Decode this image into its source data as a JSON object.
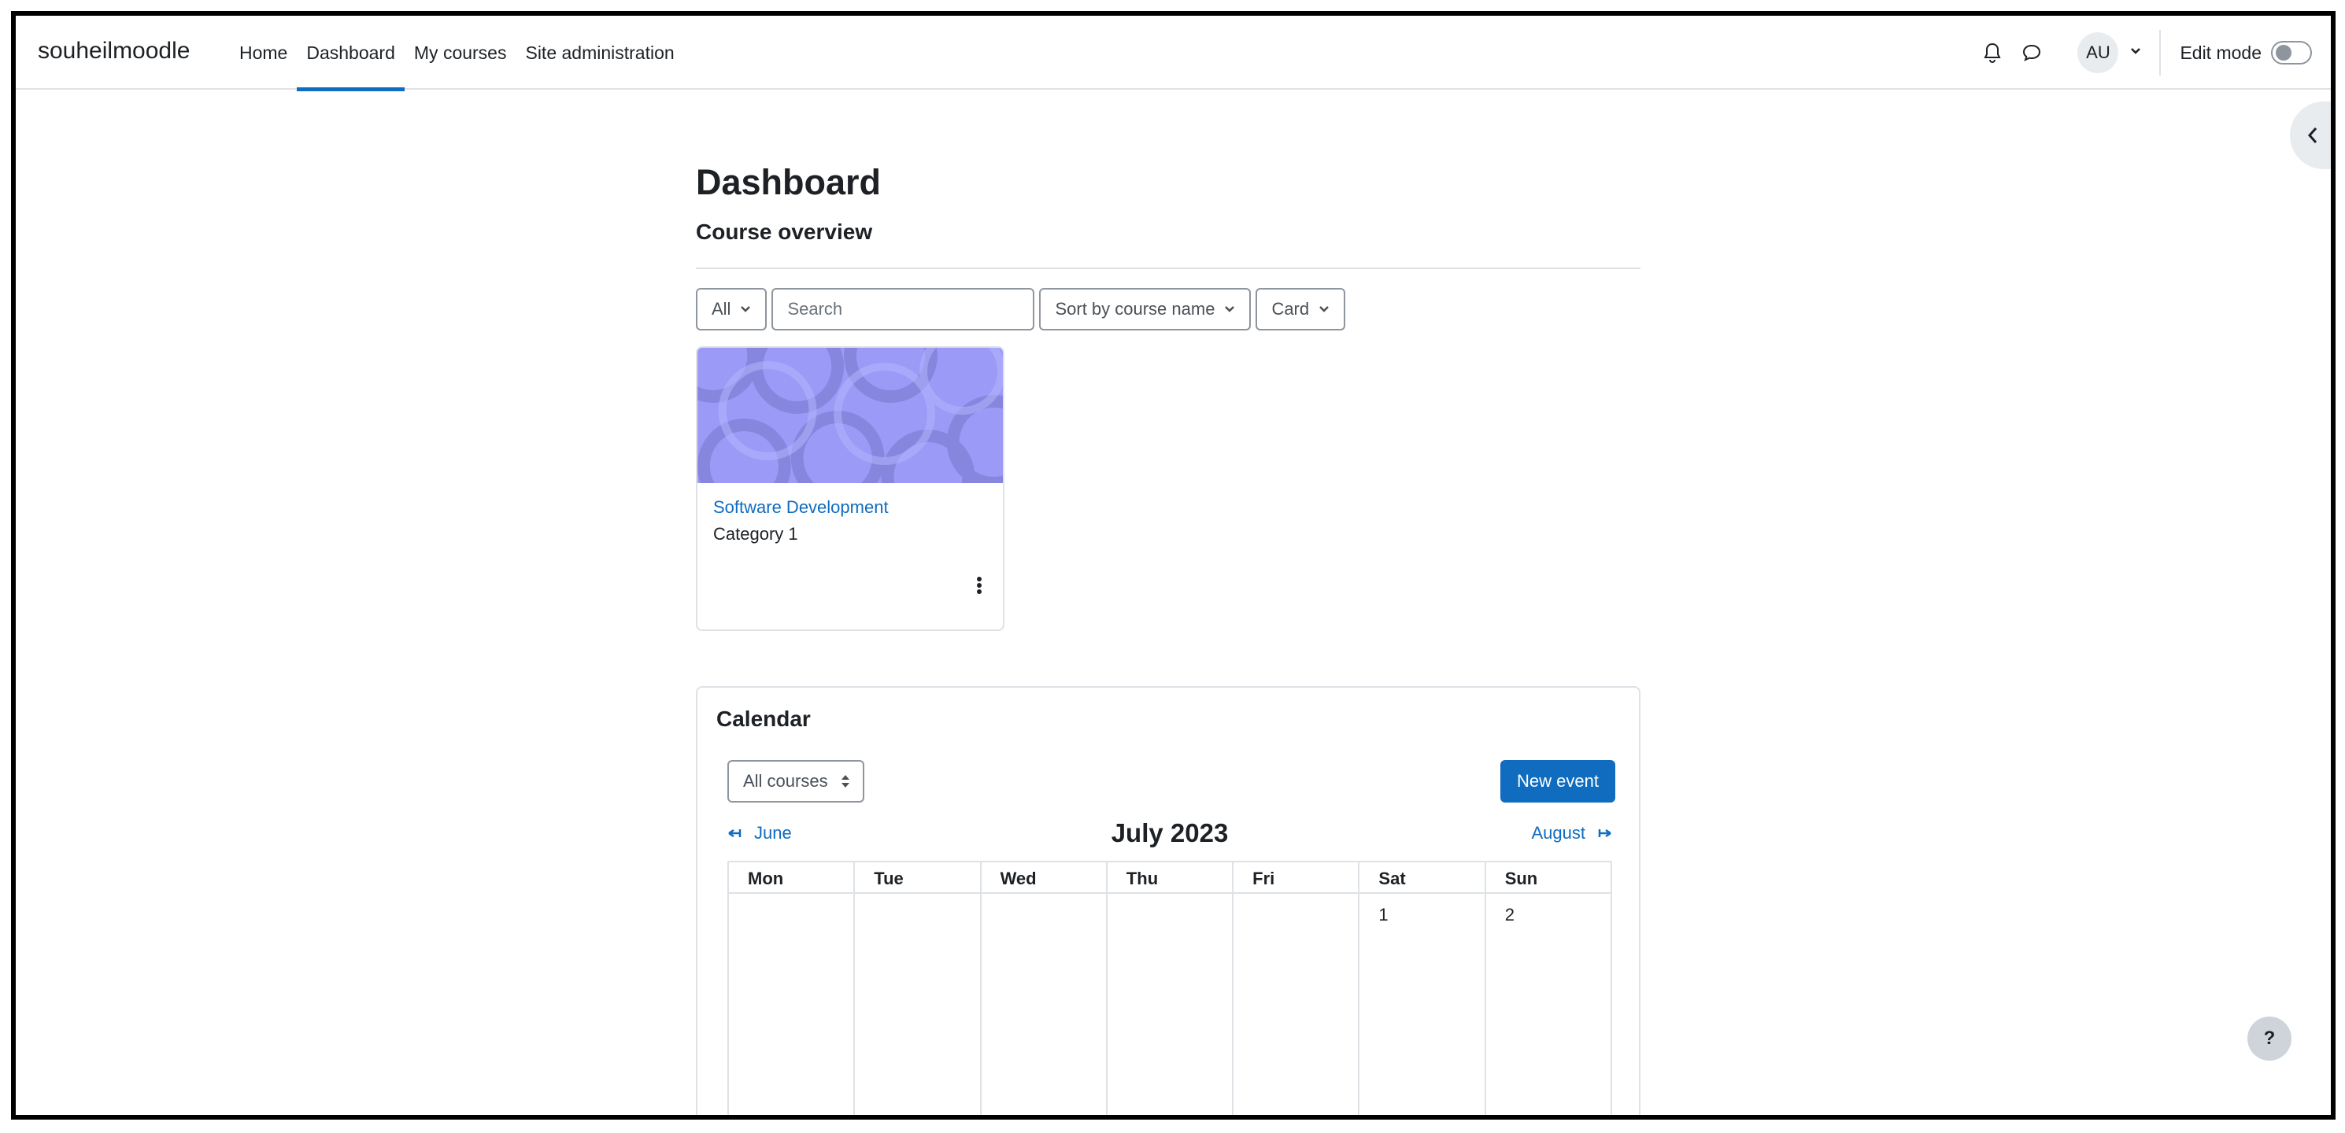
{
  "navbar": {
    "brand": "souheilmoodle",
    "links": [
      "Home",
      "Dashboard",
      "My courses",
      "Site administration"
    ],
    "active_link": "Dashboard",
    "user_initials": "AU",
    "edit_mode_label": "Edit mode",
    "edit_mode_on": false
  },
  "main": {
    "page_title": "Dashboard",
    "block_title": "Course overview",
    "filters": {
      "grouping": "All",
      "search_placeholder": "Search",
      "sort": "Sort by course name",
      "view": "Card"
    },
    "courses": [
      {
        "name": "Software Development",
        "category": "Category 1"
      }
    ]
  },
  "calendar": {
    "title": "Calendar",
    "course_filter": "All courses",
    "new_event_label": "New event",
    "prev_month": "June",
    "current_month": "July 2023",
    "next_month": "August",
    "weekdays": [
      "Mon",
      "Tue",
      "Wed",
      "Thu",
      "Fri",
      "Sat",
      "Sun"
    ],
    "first_week": [
      "",
      "",
      "",
      "",
      "",
      "1",
      "2"
    ]
  },
  "help_label": "?",
  "colors": {
    "accent": "#0f6cbf",
    "course_image": "#9b9bf7"
  }
}
